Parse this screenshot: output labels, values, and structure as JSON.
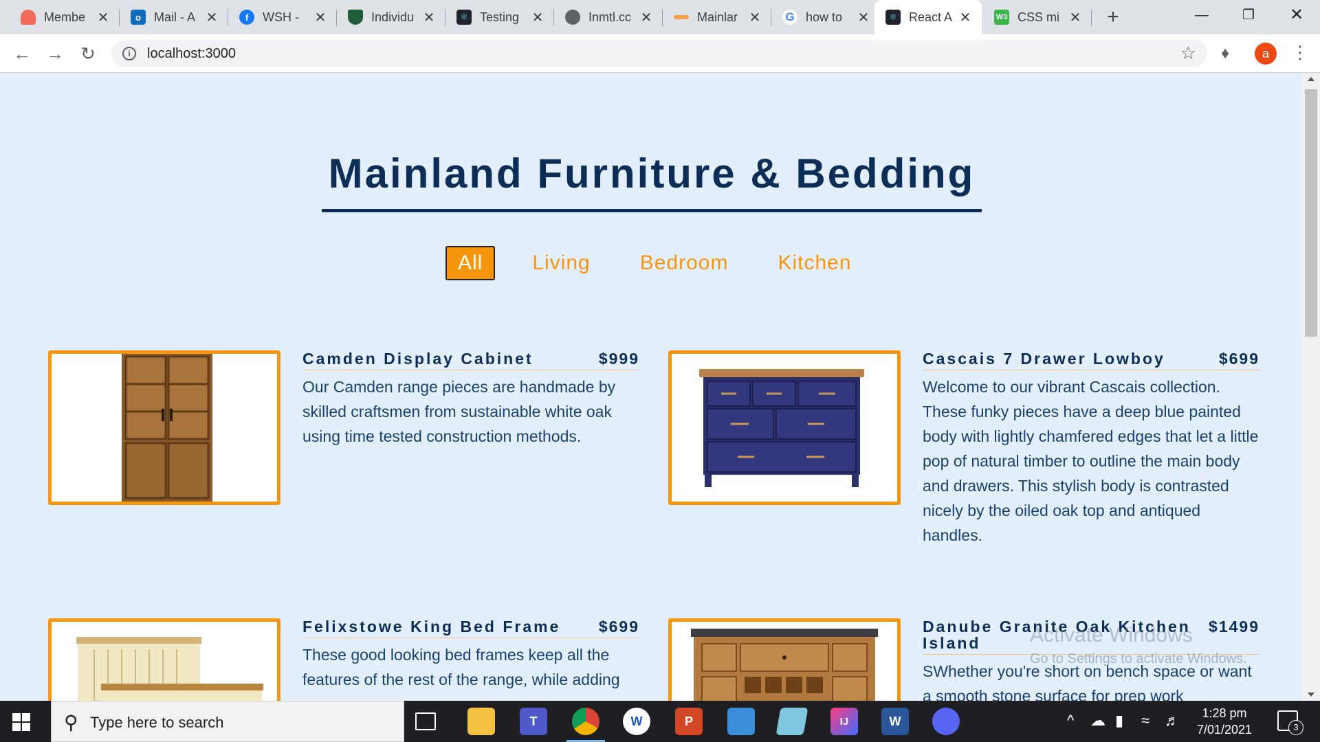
{
  "browser": {
    "tabs": [
      {
        "title": "Membe",
        "icon": "cloud-icon",
        "color": "#f26b5b"
      },
      {
        "title": "Mail - A",
        "icon": "outlook-icon",
        "color": "#0f6cbd"
      },
      {
        "title": "WSH - ",
        "icon": "facebook-icon",
        "color": "#1877f2"
      },
      {
        "title": "Individu",
        "icon": "shield-icon",
        "color": "#1e5c3a"
      },
      {
        "title": "Testing",
        "icon": "react-icon",
        "color": "#20232a"
      },
      {
        "title": "Inmtl.cc",
        "icon": "page-icon",
        "color": "#5f6368"
      },
      {
        "title": "Mainlar",
        "icon": "ruler-icon",
        "color": "#f6a04d"
      },
      {
        "title": "how to",
        "icon": "google-icon",
        "color": "#ffffff"
      },
      {
        "title": "React A",
        "icon": "react-icon",
        "color": "#20232a"
      },
      {
        "title": "CSS mi",
        "icon": "css-icon",
        "color": "#3cb44b"
      }
    ],
    "url": "localhost:3000",
    "profile_initial": "a"
  },
  "page": {
    "title": "Mainland Furniture & Bedding",
    "filters": [
      "All",
      "Living",
      "Bedroom",
      "Kitchen"
    ],
    "active_filter": "All",
    "items": [
      {
        "name": "Camden Display Cabinet",
        "price": "$999",
        "description": "Our Camden range pieces are handmade by skilled craftsmen from sustainable white oak using time tested construction methods.",
        "image": "cabinet"
      },
      {
        "name": "Cascais 7 Drawer Lowboy",
        "price": "$699",
        "description": "Welcome to our vibrant Cascais collection. These funky pieces have a deep blue painted body with lightly chamfered edges that let a little pop of natural timber to outline the main body and drawers. This stylish body is contrasted nicely by the oiled oak top and antiqued handles.",
        "image": "lowboy"
      },
      {
        "name": "Felixstowe King Bed Frame",
        "price": "$699",
        "description": "These good looking bed frames keep all the features of the rest of the range, while adding",
        "image": "bed"
      },
      {
        "name": "Danube Granite Oak Kitchen Island",
        "price": "$1499",
        "description": "SWhether you're short on bench space or want a smooth stone surface for prep work",
        "image": "island"
      }
    ]
  },
  "watermark": {
    "line1": "Activate Windows",
    "line2": "Go to Settings to activate Windows."
  },
  "taskbar": {
    "search_placeholder": "Type here to search",
    "time": "1:28 pm",
    "date": "7/01/2021",
    "notification_count": "3",
    "apps": [
      {
        "name": "task-view-icon",
        "label": ""
      },
      {
        "name": "file-explorer-icon",
        "label": ""
      },
      {
        "name": "teams-icon",
        "label": "T"
      },
      {
        "name": "chrome-icon",
        "label": ""
      },
      {
        "name": "word-pad-icon",
        "label": "W"
      },
      {
        "name": "powerpoint-icon",
        "label": "P"
      },
      {
        "name": "control-panel-icon",
        "label": ""
      },
      {
        "name": "notes-icon",
        "label": ""
      },
      {
        "name": "intellij-icon",
        "label": "IJ"
      },
      {
        "name": "word-icon",
        "label": "W"
      },
      {
        "name": "discord-icon",
        "label": ""
      }
    ]
  },
  "colors": {
    "accent": "#f6960d",
    "navy": "#0c2d56",
    "page_bg": "#e3effc"
  }
}
